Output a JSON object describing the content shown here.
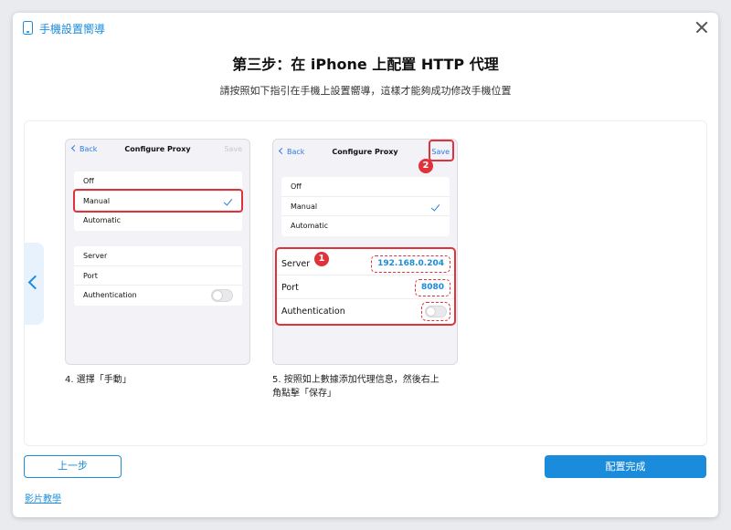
{
  "window": {
    "title": "手機設置嚮導"
  },
  "header": {
    "title": "第三步：在 iPhone 上配置 HTTP 代理",
    "subtitle": "請按照如下指引在手機上設置嚮導，這樣才能夠成功修改手機位置"
  },
  "colors": {
    "accent": "#1a8cdb",
    "highlight": "#e0323b",
    "ios_blue": "#2a7be4"
  },
  "phone1": {
    "back": "Back",
    "title": "Configure Proxy",
    "save": "Save",
    "options": [
      "Off",
      "Manual",
      "Automatic"
    ],
    "fields": [
      "Server",
      "Port",
      "Authentication"
    ]
  },
  "phone2": {
    "back": "Back",
    "title": "Configure Proxy",
    "save": "Save",
    "options": [
      "Off",
      "Manual",
      "Automatic"
    ],
    "server_label": "Server",
    "server_value": "192.168.0.204",
    "port_label": "Port",
    "port_value": "8080",
    "auth_label": "Authentication",
    "badge_proxy": "1",
    "badge_save": "2"
  },
  "captions": {
    "step4": "4. 選擇「手動」",
    "step5_line1": "5. 按照如上數據添加代理信息，然後右上",
    "step5_line2": "角點擊「保存」"
  },
  "footer": {
    "prev_label": "上一步",
    "done_label": "配置完成",
    "video_link": "影片教學"
  }
}
